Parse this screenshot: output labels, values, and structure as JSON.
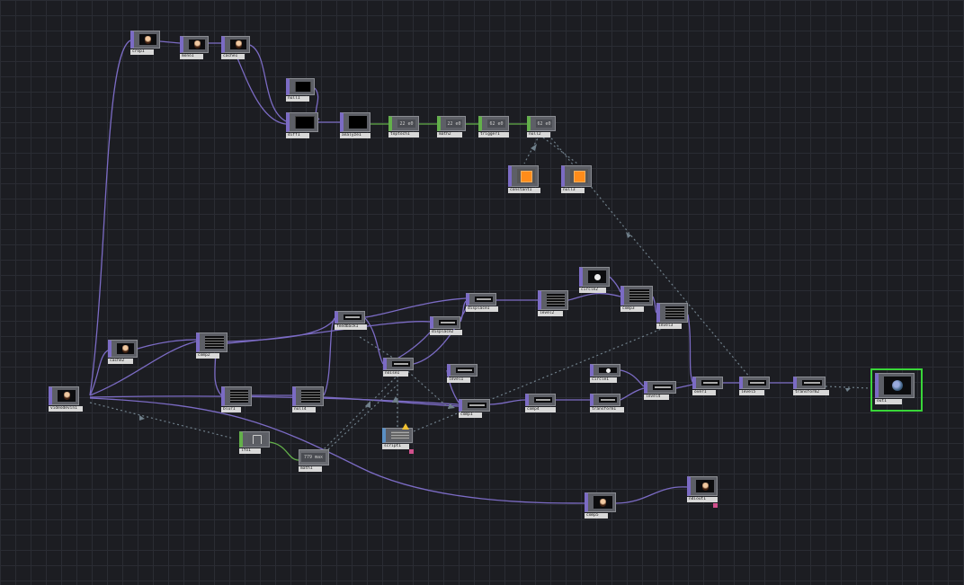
{
  "app": {
    "name": "TouchDesigner network editor"
  },
  "colors": {
    "background": "#1c1d22",
    "grid": "#2a2c33",
    "top_wire": "#7b6bc4",
    "chop_wire": "#63b04a",
    "export_wire": "#6f7f8a",
    "selection": "#39d639"
  },
  "nodes": {
    "crop1": {
      "label": "crop1",
      "icon": "face-icon"
    },
    "mono1": {
      "label": "mono1",
      "icon": "face-icon"
    },
    "cache1": {
      "label": "cache1",
      "icon": "face-icon"
    },
    "null1": {
      "label": "null1",
      "icon": "black-frame-icon"
    },
    "diff1": {
      "label": "diff1",
      "icon": "black-frame-icon"
    },
    "analyze1": {
      "label": "analyze1",
      "icon": "black-frame-icon"
    },
    "toptoch1": {
      "label": "toptoch1",
      "value": "22 e0"
    },
    "math2": {
      "label": "math2",
      "value": "22 e0"
    },
    "trigger1": {
      "label": "trigger1",
      "value": "62 e0"
    },
    "null2": {
      "label": "null2",
      "value": "62 e0"
    },
    "constant1": {
      "label": "constant1",
      "icon": "orange-swatch-icon"
    },
    "null3": {
      "label": "null3",
      "icon": "orange-swatch-icon"
    },
    "videodevin1": {
      "label": "videodevin1",
      "icon": "face-icon"
    },
    "cache2": {
      "label": "cache2",
      "icon": "face-icon"
    },
    "comp2": {
      "label": "comp2",
      "icon": "bars-icon"
    },
    "feedback1": {
      "label": "feedback1",
      "icon": "bars-icon"
    },
    "displace1": {
      "label": "displace1",
      "icon": "bars-icon"
    },
    "displace2": {
      "label": "displace2",
      "icon": "bars-icon"
    },
    "level2": {
      "label": "level2",
      "icon": "bars-icon"
    },
    "circle2": {
      "label": "circle2",
      "icon": "dot-icon"
    },
    "comp3": {
      "label": "comp3",
      "icon": "bars-icon"
    },
    "level3": {
      "label": "level3",
      "icon": "bars-icon"
    },
    "blur1": {
      "label": "blur1",
      "icon": "bars-icon"
    },
    "null4": {
      "label": "null4",
      "icon": "bars-icon"
    },
    "noise1": {
      "label": "noise1",
      "icon": "bars-icon"
    },
    "level1": {
      "label": "level1",
      "icon": "bars-icon"
    },
    "circle1": {
      "label": "circle1",
      "icon": "dot-icon"
    },
    "comp1": {
      "label": "comp1",
      "icon": "bars-icon"
    },
    "comp4": {
      "label": "comp4",
      "icon": "bars-icon"
    },
    "transform1": {
      "label": "transform1",
      "icon": "bars-icon"
    },
    "level4": {
      "label": "level4",
      "icon": "bars-icon"
    },
    "over1": {
      "label": "over1",
      "icon": "bars-icon"
    },
    "level5": {
      "label": "level5",
      "icon": "bars-icon"
    },
    "transform2": {
      "label": "transform2",
      "icon": "bars-icon"
    },
    "out1": {
      "label": "out1",
      "icon": "globe-icon"
    },
    "lfo1": {
      "label": "lfo1",
      "icon": "wave-icon"
    },
    "math1": {
      "label": "math1",
      "value": "779 max"
    },
    "script1": {
      "label": "script1",
      "icon": "warning-icon"
    },
    "comp5": {
      "label": "comp5",
      "icon": "face-icon"
    },
    "ndiout1": {
      "label": "ndiout1",
      "icon": "face-icon"
    }
  }
}
